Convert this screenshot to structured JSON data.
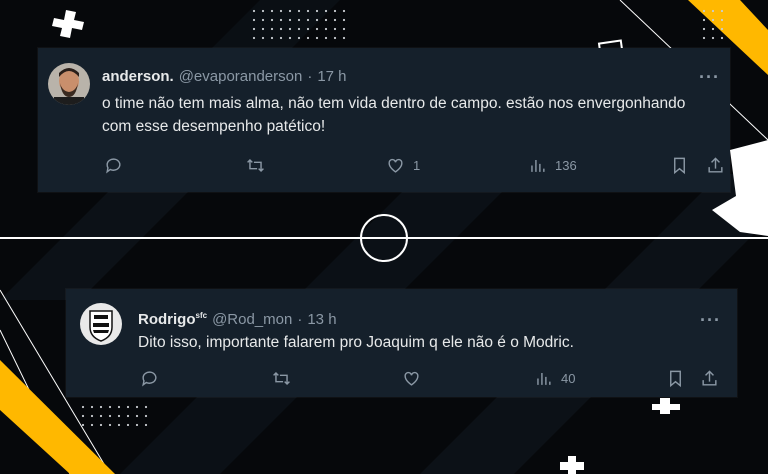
{
  "tweets": [
    {
      "name": "anderson.",
      "handle": "@evaporanderson",
      "separator": "·",
      "time": "17 h",
      "text": "o time não tem mais alma, não tem vida dentro de campo. estão nos envergonhando com esse desempenho patético!",
      "likes": "1",
      "views": "136",
      "more": "···"
    },
    {
      "name": "Rodrigo",
      "name_badge": "sfc",
      "handle": "@Rod_mon",
      "separator": "·",
      "time": "13 h",
      "text": "Dito isso, importante falarem pro Joaquim q ele não é o Modric.",
      "views": "40",
      "more": "···"
    }
  ],
  "colors": {
    "card": "#15202b",
    "text": "#e7e9ea",
    "muted": "#8b98a5",
    "accent_yellow": "#ffb800",
    "field_line": "#ffffff",
    "background": "#06080b"
  },
  "icons": [
    "reply-icon",
    "retweet-icon",
    "like-icon",
    "views-icon",
    "bookmark-icon",
    "share-icon",
    "more-icon"
  ]
}
